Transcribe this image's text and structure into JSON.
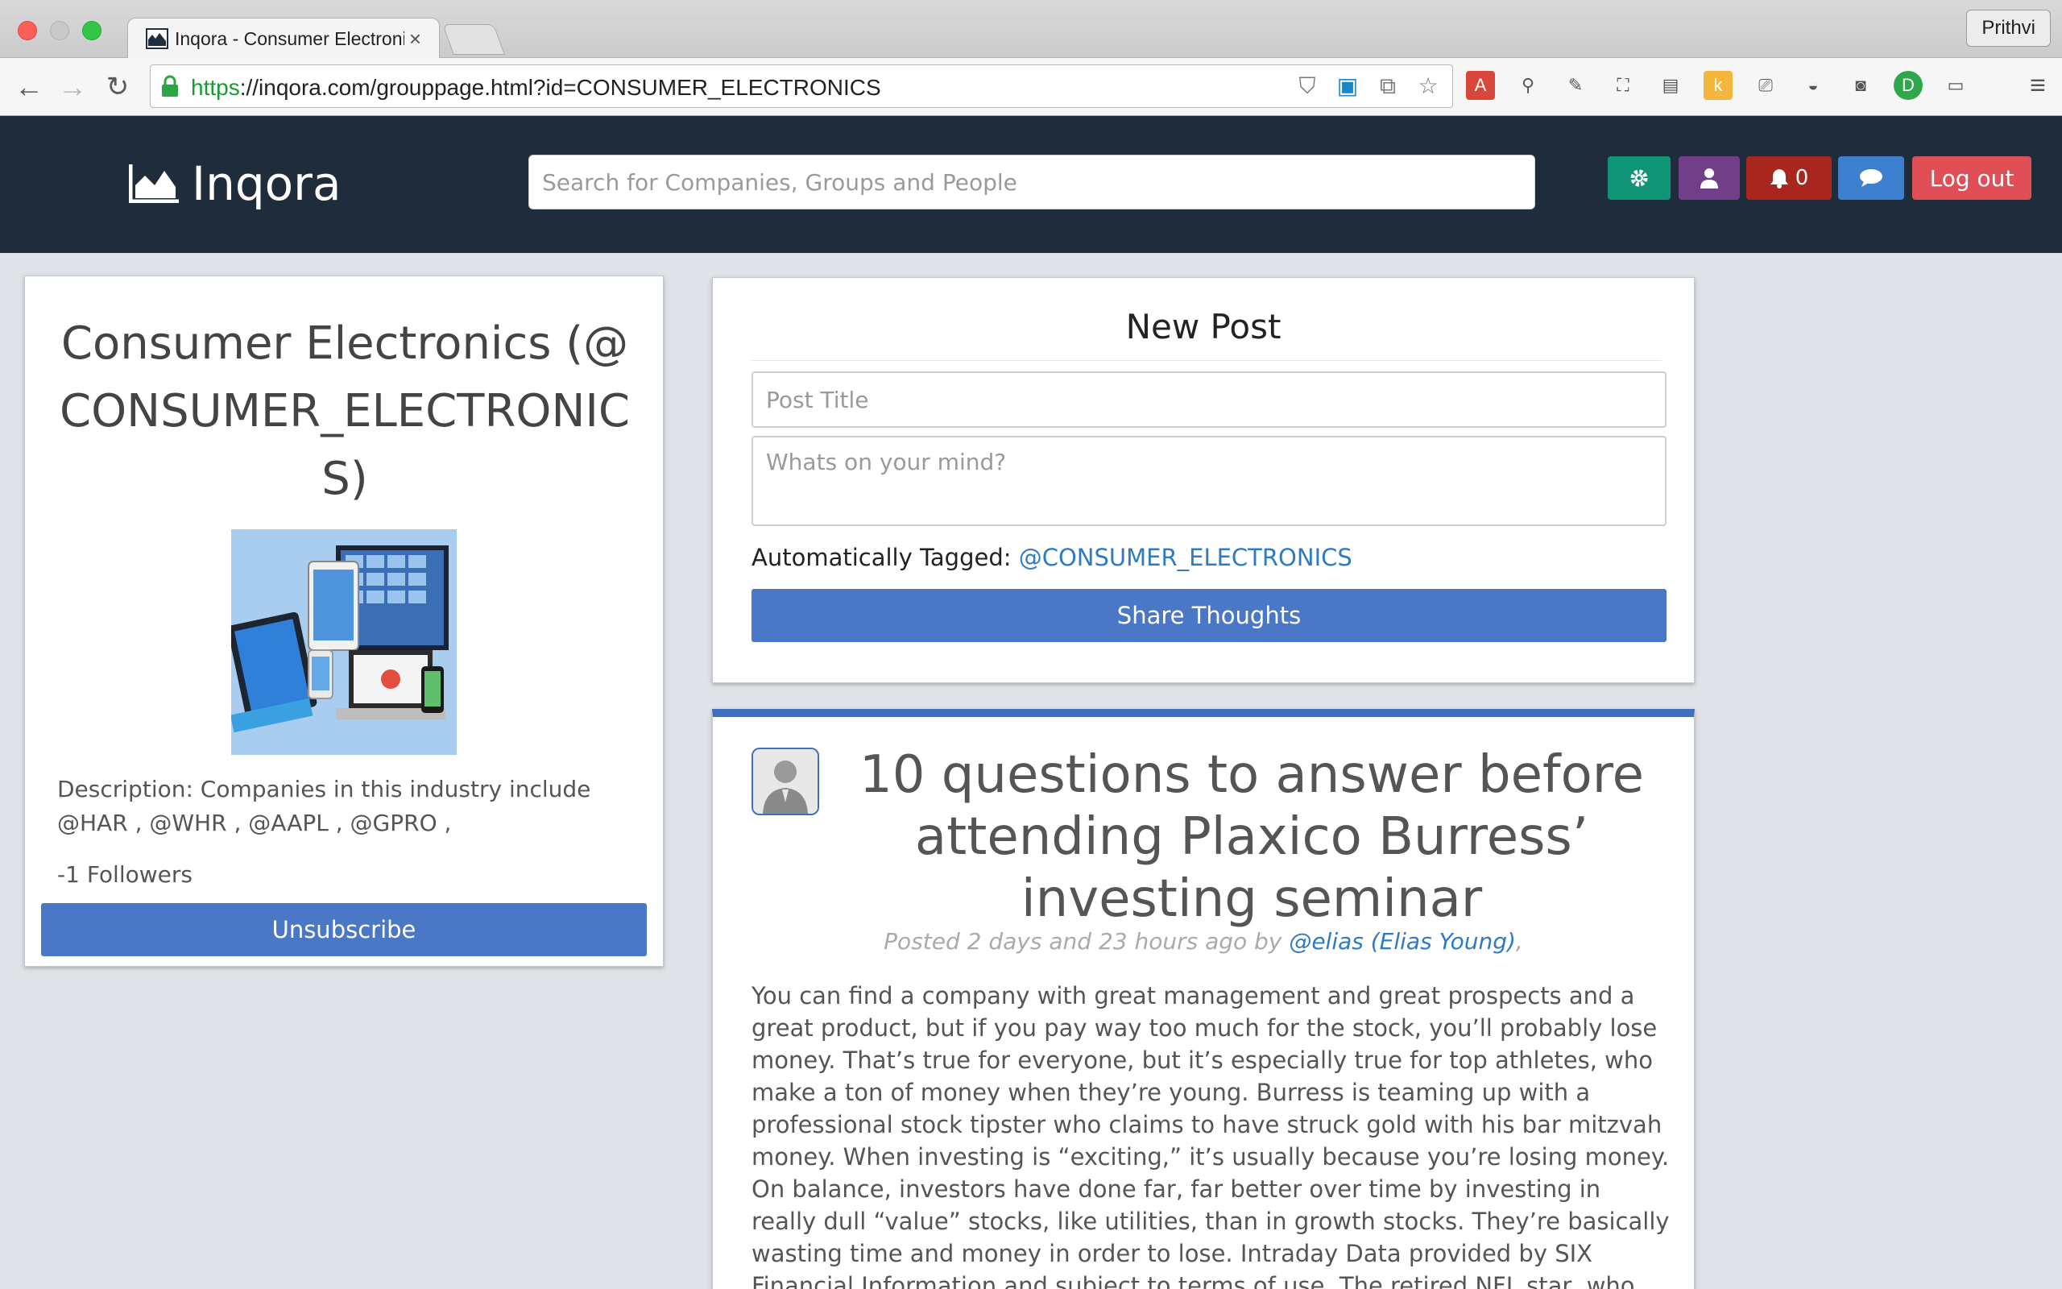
{
  "browser": {
    "tab_title": "Inqora - Consumer Electronics",
    "url_scheme": "https",
    "url_rest": "://inqora.com/grouppage.html?id=CONSUMER_ELECTRONICS",
    "profile_name": "Prithvi"
  },
  "header": {
    "brand": "Inqora",
    "search_placeholder": "Search for Companies, Groups and People",
    "notification_count": "0",
    "logout_label": "Log out"
  },
  "group": {
    "title": "Consumer Electronics (@CONSUMER_ELECTRONICS)",
    "description": "Description: Companies in this industry include @HAR , @WHR , @AAPL , @GPRO ,",
    "followers": "-1 Followers",
    "unsubscribe_label": "Unsubscribe"
  },
  "new_post": {
    "heading": "New Post",
    "title_placeholder": "Post Title",
    "body_placeholder": "Whats on your mind?",
    "auto_tag_label": "Automatically Tagged:",
    "auto_tag_value": "@CONSUMER_ELECTRONICS",
    "share_label": "Share Thoughts"
  },
  "post": {
    "title": "10 questions to answer before attending Plaxico Burress’ investing seminar",
    "meta_prefix": "Posted 2 days and 23 hours ago by",
    "author": "@elias (Elias Young)",
    "meta_suffix": ",",
    "body": "You can find a company with great management and great prospects and a great product, but if you pay way too much for the stock, you’ll probably lose money. That’s true for everyone, but it’s especially true for top athletes, who make a ton of money when they’re young. Burress is teaming up with a professional stock tipster who claims to have struck gold with his bar mitzvah money. When investing is “exciting,” it’s usually because you’re losing money. On balance, investors have done far, far better over time by investing in really dull “value” stocks, like utilities, than in growth stocks. They’re basically wasting time and money in order to lose. Intraday Data provided by SIX Financial Information and subject to terms of use. The retired NFL star, who once ended up in chokey after shooting himself in the leg with a Glock"
  },
  "colors": {
    "header_bg": "#1e2c3b",
    "primary_button": "#4b78c6",
    "link": "#2e7bc4",
    "settings_btn": "#0f9476",
    "profile_btn": "#713f87",
    "notif_btn": "#a8261d",
    "chat_btn": "#3f7fd0",
    "logout_btn": "#e04f55"
  }
}
